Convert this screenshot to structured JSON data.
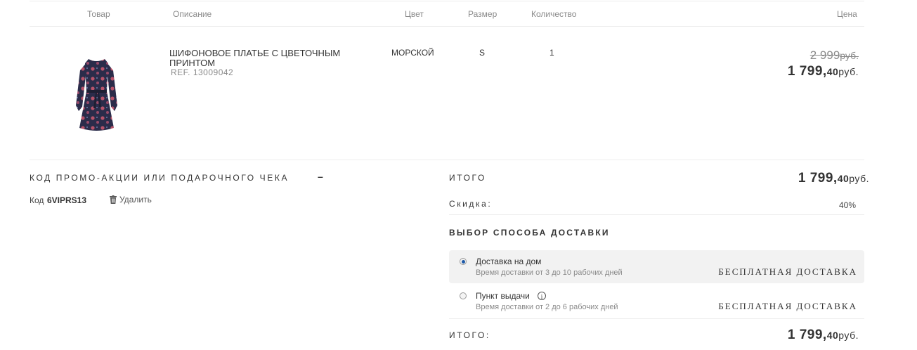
{
  "cart": {
    "columns": {
      "product": "Товар",
      "description": "Описание",
      "color": "Цвет",
      "size": "Размер",
      "quantity": "Количество",
      "price": "Цена"
    },
    "item": {
      "name": "ШИФОНОВОЕ ПЛАТЬЕ С ЦВЕТОЧНЫМ ПРИНТОМ",
      "ref": "REF. 13009042",
      "color": "МОРСКОЙ",
      "size": "S",
      "quantity": "1",
      "old_price": "2 999",
      "old_price_currency": "руб.",
      "price_main": "1 799,",
      "price_cents": "40",
      "price_currency": "руб."
    }
  },
  "promo": {
    "title": "КОД ПРОМО-АКЦИИ ИЛИ ПОДАРОЧНОГО ЧЕКА",
    "toggle": "–",
    "code_label": "Код",
    "code_value": "6VIPRS13",
    "remove_label": "Удалить"
  },
  "summary": {
    "subtotal_label": "ИТОГО",
    "subtotal_main": "1 799,",
    "subtotal_cents": "40",
    "subtotal_currency": "руб.",
    "discount_label": "Скидка:",
    "discount_value": "40%",
    "delivery_title": "ВЫБОР СПОСОБА ДОСТАВКИ",
    "options": [
      {
        "label": "Доставка на дом",
        "time": "Время доставки от 3 до 10 рабочих дней",
        "cost": "БЕСПЛАТНАЯ ДОСТАВКА",
        "selected": true
      },
      {
        "label": "Пункт выдачи",
        "time": "Время доставки от 2 до 6 рабочих дней",
        "cost": "БЕСПЛАТНАЯ ДОСТАВКА",
        "selected": false
      }
    ],
    "info_glyph": "i",
    "total_label": "ИТОГО:",
    "total_main": "1 799,",
    "total_cents": "40",
    "total_currency": "руб."
  },
  "colors": {
    "accent": "#1e5aa8",
    "selected_bg": "#f2f2f2",
    "dress_base": "#2b2c4a",
    "dress_flower": "#b8536a"
  },
  "icons": {
    "trash": "trash-icon",
    "info": "info-icon",
    "radio": "radio-icon"
  }
}
